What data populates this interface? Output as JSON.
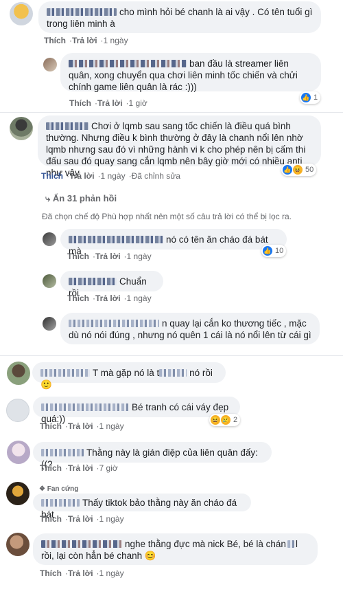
{
  "actions": {
    "like": "Thích",
    "reply": "Trả lời",
    "edited": "Đã chỉnh sửa",
    "separator": "·"
  },
  "comments": [
    {
      "text": "cho mình hỏi bé chanh là ai vậy . Có tên tuổi gì trong liên minh à",
      "time": "1 ngày"
    },
    {
      "text": "ban đầu là streamer liên quân, xong chuyển qua chơi liên minh tốc chiến và chửi chính game liên quân là rác :)))",
      "time": "1 giờ",
      "reaction_count": "1",
      "reaction_icons": [
        "like-icon"
      ]
    },
    {
      "text_line1": "Chơi ở lqmb sau sang tốc chiến là điều quá bình",
      "text_rest": "thường. Nhưng điều k bình thường ở đây là chanh nổi lên nhờ lqmb nhưng sau đó vì những hành vi k cho phép nên bị cấm thi đấu sau đó quay sang cắn lqmb nên bây giờ mới có nhiều anti như vậy",
      "time": "1 ngày",
      "reaction_count": "50",
      "reaction_icons": [
        "like-icon",
        "haha-icon"
      ]
    },
    {
      "text": "nó có tên ăn cháo đá bát mà",
      "time": "1 ngày",
      "reaction_count": "10",
      "reaction_icons": [
        "like-icon"
      ]
    },
    {
      "text": "Chuẩn rồi",
      "time": "1 ngày"
    },
    {
      "text_line1": "n quay lại cắn ko thương tiếc , mặc dù",
      "text_rest": "nó nói đúng , nhưng nó quên 1 cái là nó nổi lên từ cái gì"
    },
    {
      "text": "T mà gặp nó là t",
      "text_after": " nó rồi 🙂"
    },
    {
      "text": "Bé tranh có cái váy đẹp quá:))",
      "time": "1 ngày",
      "reaction_count": "2",
      "reaction_icons": [
        "haha-icon",
        "sad-icon"
      ]
    },
    {
      "text": "Thằng này là gián điệp của liên quân đấy:((?",
      "time": "7 giờ"
    },
    {
      "badge": "Fan cứng",
      "text": "Thấy tiktok bảo thằng này ăn cháo đá bát",
      "time": "1 ngày"
    },
    {
      "text_line1": "nghe thằng đực mà nick Bé, bé là chán",
      "text_mid": "l rồi, lại",
      "text_rest": "còn hẳn bé chanh 😊",
      "time": "1 ngày"
    }
  ],
  "more_replies": "Ẩn 31 phản hồi",
  "filter_notice": "Đã chọn chế độ Phù hợp nhất nên một số câu trả lời có thể bị lọc ra.",
  "colors": {
    "bubble": "#f0f2f5",
    "link_blue": "#385898",
    "meta_gray": "#65676b",
    "like_blue": "#1877f2"
  }
}
